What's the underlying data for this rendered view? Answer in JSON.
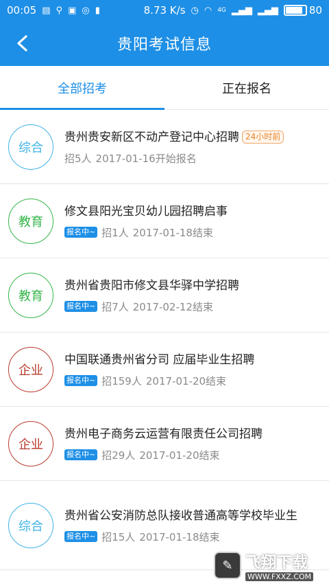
{
  "status_bar": {
    "time": "00:05",
    "speed": "8.73 K/s",
    "battery": "80",
    "battery_level": 0.8,
    "net_label": "4G"
  },
  "header": {
    "title": "贵阳考试信息",
    "back_icon": "chevron-left-icon"
  },
  "tabs": [
    {
      "label": "全部招考",
      "active": true
    },
    {
      "label": "正在报名",
      "active": false
    }
  ],
  "colors": {
    "brand": "#1e8fe6",
    "zonghe": "#3fb3e6",
    "jiaoyu": "#35b54a",
    "qiye": "#b83b2d",
    "new_badge": "#e8862a"
  },
  "items": [
    {
      "category": "综合",
      "title": "贵州贵安新区不动产登记中心招聘",
      "badge": "24小时前",
      "tag": "",
      "count": "招5人",
      "date": "2017-01-16开始报名"
    },
    {
      "category": "教育",
      "title": "修文县阳光宝贝幼儿园招聘启事",
      "badge": "",
      "tag": "报名中~",
      "count": "招1人",
      "date": "2017-01-18结束"
    },
    {
      "category": "教育",
      "title": "贵州省贵阳市修文县华驿中学招聘",
      "badge": "",
      "tag": "报名中~",
      "count": "招7人",
      "date": "2017-02-12结束"
    },
    {
      "category": "企业",
      "title": "中国联通贵州省分司 应届毕业生招聘",
      "badge": "",
      "tag": "报名中~",
      "count": "招159人",
      "date": "2017-01-20结束"
    },
    {
      "category": "企业",
      "title": "贵州电子商务云运营有限责任公司招聘",
      "badge": "",
      "tag": "报名中~",
      "count": "招29人",
      "date": "2017-01-20结束"
    },
    {
      "category": "综合",
      "title": "贵州省公安消防总队接收普通高等学校毕业生",
      "badge": "",
      "tag": "报名中~",
      "count": "招15人",
      "date": "2017-01-18结束"
    }
  ],
  "watermark": {
    "name": "飞翔下载",
    "url": "WWW.FXXZ.COM"
  }
}
